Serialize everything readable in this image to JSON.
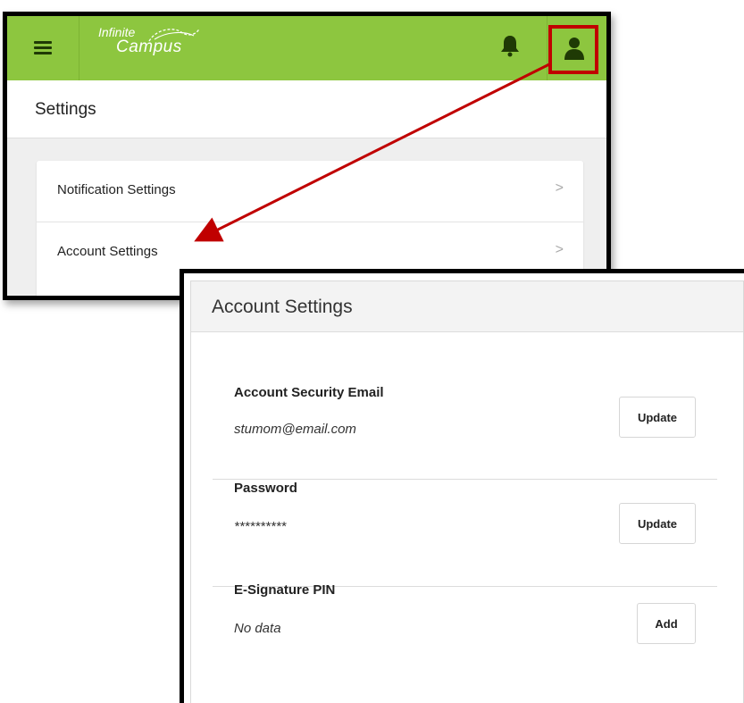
{
  "app": {
    "logo_line1": "Infinite",
    "logo_line2": "Campus"
  },
  "header": {
    "menu_icon": "hamburger-icon",
    "notifications_icon": "bell-icon",
    "user_icon": "user-icon",
    "brand_color": "#8dc63f",
    "highlight_color": "#c00000"
  },
  "settings_page": {
    "title": "Settings",
    "items": [
      {
        "label": "Notification Settings",
        "icon": "chevron-right-icon",
        "chevron": ">"
      },
      {
        "label": "Account Settings",
        "icon": "chevron-right-icon",
        "chevron": ">"
      }
    ]
  },
  "account_settings": {
    "title": "Account Settings",
    "sections": [
      {
        "name": "Account Security Email",
        "value": "stumom@email.com",
        "button": "Update"
      },
      {
        "name": "Password",
        "value": "**********",
        "button": "Update"
      },
      {
        "name": "E-Signature PIN",
        "value": "No data",
        "button": "Add"
      }
    ]
  },
  "annotation": {
    "arrow_color": "#c00000"
  }
}
